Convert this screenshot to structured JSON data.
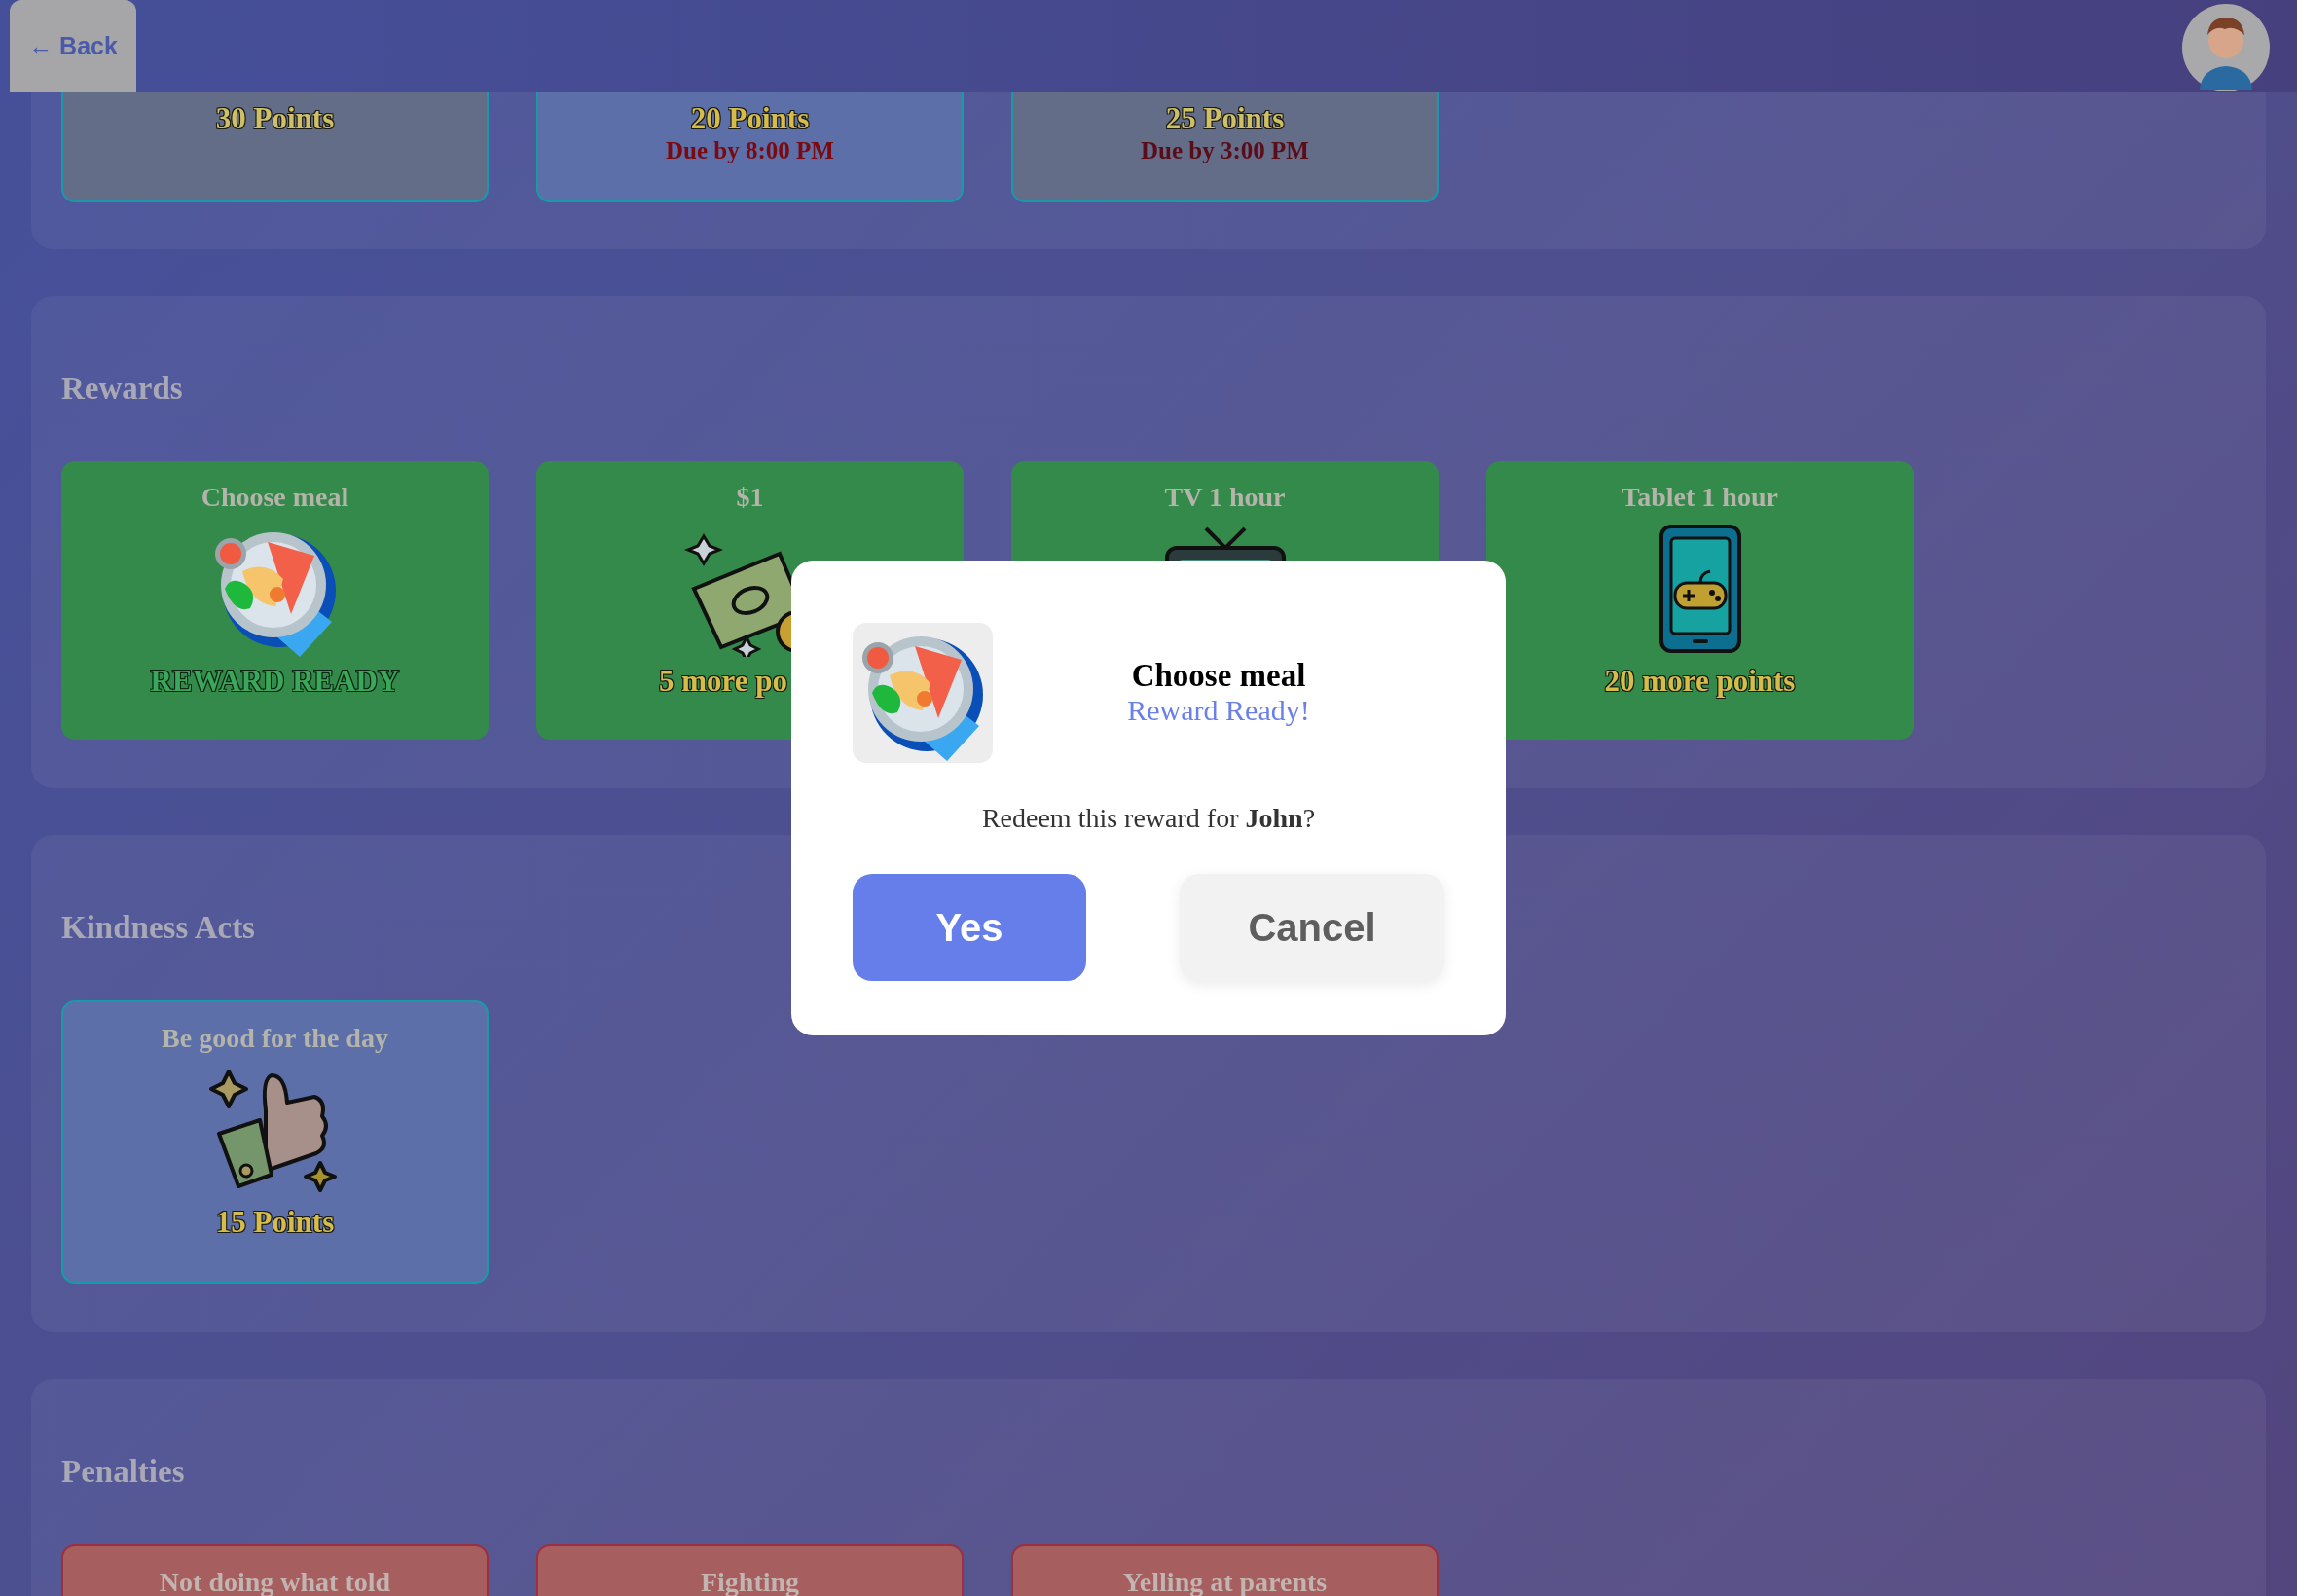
{
  "top_bar": {
    "back_button": "← Back"
  },
  "sections": [
    {
      "kind": "chores",
      "cards": [
        {
          "points": "30 Points",
          "disabled": true
        },
        {
          "points": "20 Points",
          "due": "Due by 8:00 PM",
          "disabled": false
        },
        {
          "points": "25 Points",
          "due": "Due by 3:00 PM",
          "disabled": true
        }
      ]
    },
    {
      "kind": "rewards",
      "title": "Rewards",
      "cards": [
        {
          "title": "Choose meal",
          "kind": "meal",
          "status": "REWARD READY",
          "ready": true
        },
        {
          "title": "$1",
          "kind": "money",
          "status": "5 more po",
          "ready": false
        },
        {
          "title": "TV 1 hour",
          "kind": "tv"
        },
        {
          "title": "Tablet 1 hour",
          "kind": "tablet",
          "status": "20 more points",
          "ready": false
        }
      ]
    },
    {
      "kind": "kindness",
      "title": "Kindness Acts",
      "cards": [
        {
          "title": "Be good for the day",
          "kind": "thumb",
          "points": "15 Points"
        }
      ]
    },
    {
      "kind": "penalties",
      "title": "Penalties",
      "cards": [
        {
          "title": "Not doing what told"
        },
        {
          "title": "Fighting"
        },
        {
          "title": "Yelling at parents"
        }
      ]
    }
  ],
  "dialog": {
    "title": "Choose meal",
    "subtitle": "Reward Ready!",
    "message": "Redeem this reward for **John**?",
    "buttons": [
      {
        "label": "Yes",
        "kind": "primary"
      },
      {
        "label": "Cancel",
        "kind": "secondary"
      }
    ]
  }
}
